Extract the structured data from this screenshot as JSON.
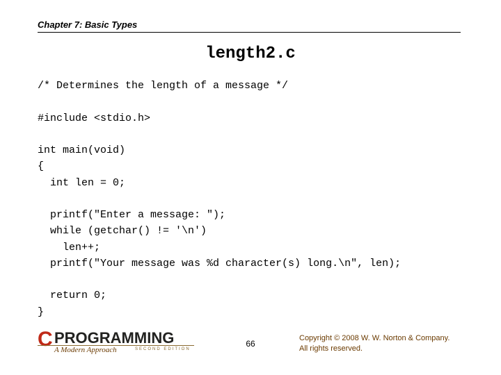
{
  "chapter": "Chapter 7: Basic Types",
  "title": "length2.c",
  "code": "/* Determines the length of a message */\n\n#include <stdio.h>\n\nint main(void)\n{\n  int len = 0;\n\n  printf(\"Enter a message: \");\n  while (getchar() != '\\n')\n    len++;\n  printf(\"Your message was %d character(s) long.\\n\", len);\n\n  return 0;\n}",
  "page_number": "66",
  "copyright_line1": "Copyright © 2008 W. W. Norton & Company.",
  "copyright_line2": "All rights reserved.",
  "logo": {
    "c": "C",
    "programming": "PROGRAMMING",
    "sub": "A Modern Approach",
    "edition": "SECOND EDITION"
  }
}
